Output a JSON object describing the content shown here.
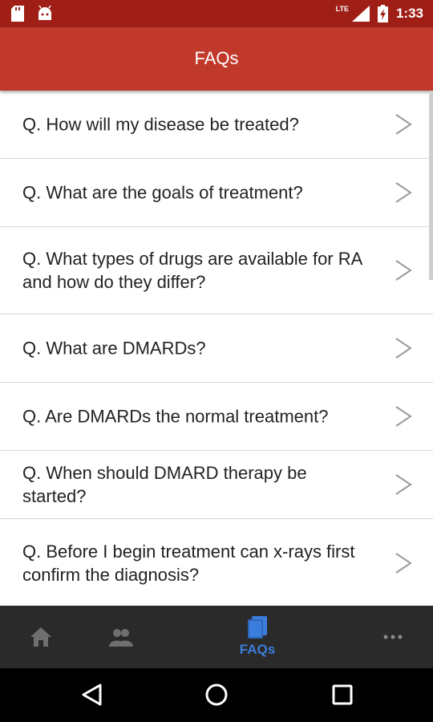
{
  "status_bar": {
    "network_label": "LTE",
    "time": "1:33",
    "icons": [
      "sd-card-icon",
      "android-icon",
      "signal-icon",
      "battery-charging-icon"
    ]
  },
  "header": {
    "title": "FAQs"
  },
  "faq_items": [
    {
      "question": "Q. How will my disease be treated?"
    },
    {
      "question": "Q. What are the goals of treatment?"
    },
    {
      "question": "Q. What types of drugs are available for RA and how do they differ?"
    },
    {
      "question": "Q. What are DMARDs?"
    },
    {
      "question": "Q. Are DMARDs the normal treatment?"
    },
    {
      "question": "Q. When should DMARD therapy be started?"
    },
    {
      "question": "Q. Before I begin treatment can x-rays first confirm the diagnosis?"
    }
  ],
  "bottom_nav": {
    "items": [
      {
        "icon": "home-icon",
        "label": ""
      },
      {
        "icon": "people-icon",
        "label": ""
      },
      {
        "icon": "book-icon",
        "label": "FAQs",
        "active": true
      },
      {
        "icon": "more-icon",
        "label": ""
      }
    ]
  },
  "system_nav": {
    "icons": [
      "back-icon",
      "home-circle-icon",
      "recents-icon"
    ]
  },
  "colors": {
    "status_bar": "#9f1f17",
    "app_bar": "#c0392b",
    "accent": "#3b7ddd",
    "nav_bg": "#2a2a2a"
  }
}
